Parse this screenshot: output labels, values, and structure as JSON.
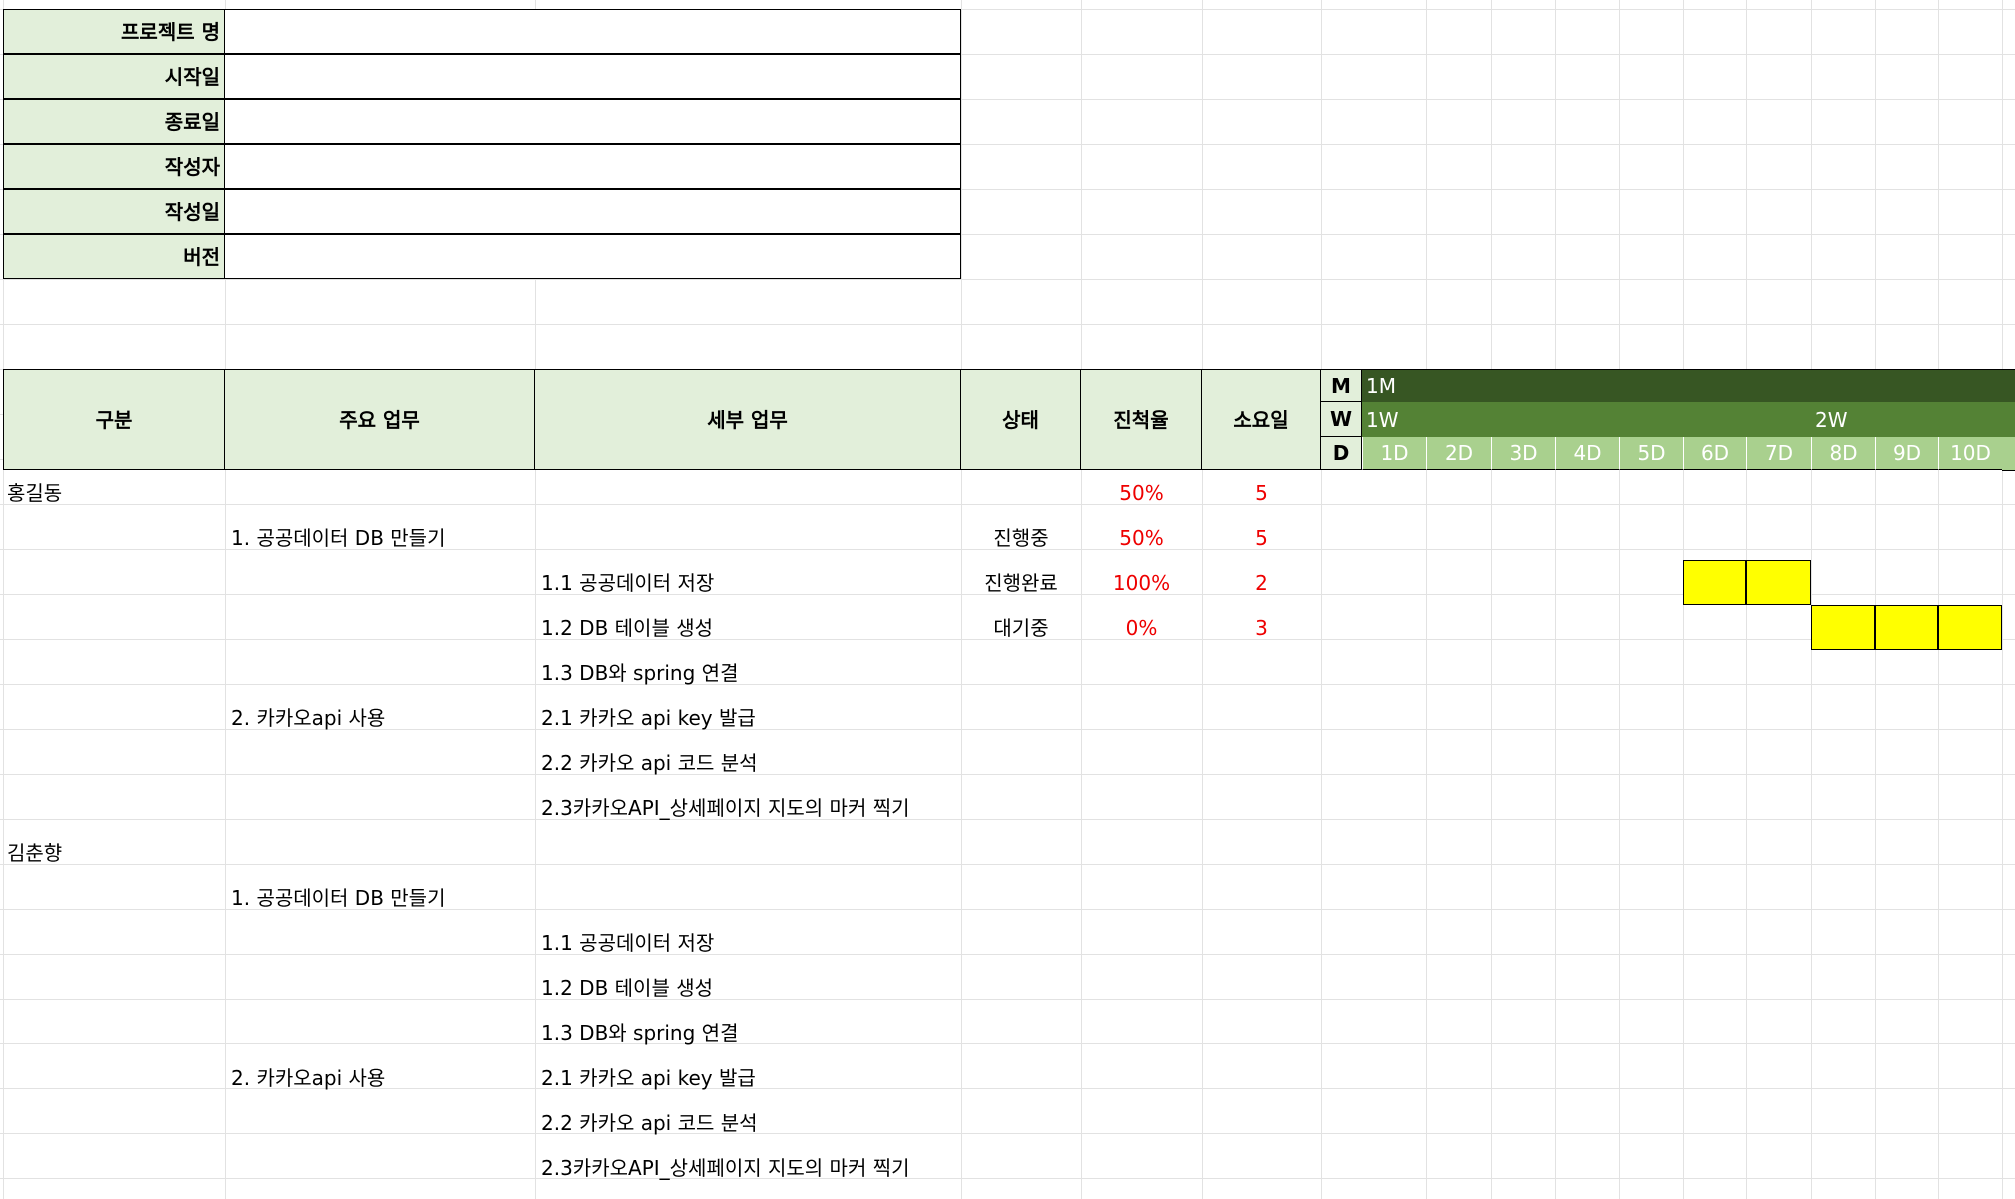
{
  "colors": {
    "header_fill": "#e2efda",
    "month_fill": "#375623",
    "week_fill": "#548235",
    "day_fill": "#a9d08e",
    "bar_fill": "#ffff00",
    "red_text": "#ee0000"
  },
  "info": [
    {
      "label": "프로젝트 명",
      "value": ""
    },
    {
      "label": "시작일",
      "value": ""
    },
    {
      "label": "종료일",
      "value": ""
    },
    {
      "label": "작성자",
      "value": ""
    },
    {
      "label": "작성일",
      "value": ""
    },
    {
      "label": "버전",
      "value": ""
    }
  ],
  "headers": [
    "구분",
    "주요 업무",
    "세부 업무",
    "상태",
    "진척율",
    "소요일"
  ],
  "timeline": {
    "row_labels": [
      "M",
      "W",
      "D"
    ],
    "months": [
      "1M"
    ],
    "weeks": [
      "1W",
      "2W"
    ],
    "days": [
      "1D",
      "2D",
      "3D",
      "4D",
      "5D",
      "6D",
      "7D",
      "8D",
      "9D",
      "10D"
    ]
  },
  "rows": [
    {
      "group": "홍길동",
      "main": "",
      "detail": "",
      "status": "",
      "progress": "50%",
      "days": "5",
      "bar": []
    },
    {
      "group": "",
      "main": "1. 공공데이터 DB 만들기",
      "detail": "",
      "status": "진행중",
      "progress": "50%",
      "days": "5",
      "bar": []
    },
    {
      "group": "",
      "main": "",
      "detail": "1.1 공공데이터 저장",
      "status": "진행완료",
      "progress": "100%",
      "days": "2",
      "bar": [
        6,
        7
      ]
    },
    {
      "group": "",
      "main": "",
      "detail": "1.2 DB 테이블 생성",
      "status": "대기중",
      "progress": "0%",
      "days": "3",
      "bar": [
        8,
        9,
        10
      ]
    },
    {
      "group": "",
      "main": "",
      "detail": "1.3 DB와 spring 연결",
      "status": "",
      "progress": "",
      "days": "",
      "bar": []
    },
    {
      "group": "",
      "main": "2. 카카오api 사용",
      "detail": "2.1 카카오 api key 발급",
      "status": "",
      "progress": "",
      "days": "",
      "bar": []
    },
    {
      "group": "",
      "main": "",
      "detail": "2.2 카카오 api 코드 분석",
      "status": "",
      "progress": "",
      "days": "",
      "bar": []
    },
    {
      "group": "",
      "main": "",
      "detail": "2.3카카오API_상세페이지 지도의 마커 찍기",
      "status": "",
      "progress": "",
      "days": "",
      "bar": []
    },
    {
      "group": "김춘향",
      "main": "",
      "detail": "",
      "status": "",
      "progress": "",
      "days": "",
      "bar": []
    },
    {
      "group": "",
      "main": "1. 공공데이터 DB 만들기",
      "detail": "",
      "status": "",
      "progress": "",
      "days": "",
      "bar": []
    },
    {
      "group": "",
      "main": "",
      "detail": "1.1 공공데이터 저장",
      "status": "",
      "progress": "",
      "days": "",
      "bar": []
    },
    {
      "group": "",
      "main": "",
      "detail": "1.2 DB 테이블 생성",
      "status": "",
      "progress": "",
      "days": "",
      "bar": []
    },
    {
      "group": "",
      "main": "",
      "detail": "1.3 DB와 spring 연결",
      "status": "",
      "progress": "",
      "days": "",
      "bar": []
    },
    {
      "group": "",
      "main": "2. 카카오api 사용",
      "detail": "2.1 카카오 api key 발급",
      "status": "",
      "progress": "",
      "days": "",
      "bar": []
    },
    {
      "group": "",
      "main": "",
      "detail": "2.2 카카오 api 코드 분석",
      "status": "",
      "progress": "",
      "days": "",
      "bar": []
    },
    {
      "group": "",
      "main": "",
      "detail": "2.3카카오API_상세페이지 지도의 마커 찍기",
      "status": "",
      "progress": "",
      "days": "",
      "bar": []
    }
  ]
}
